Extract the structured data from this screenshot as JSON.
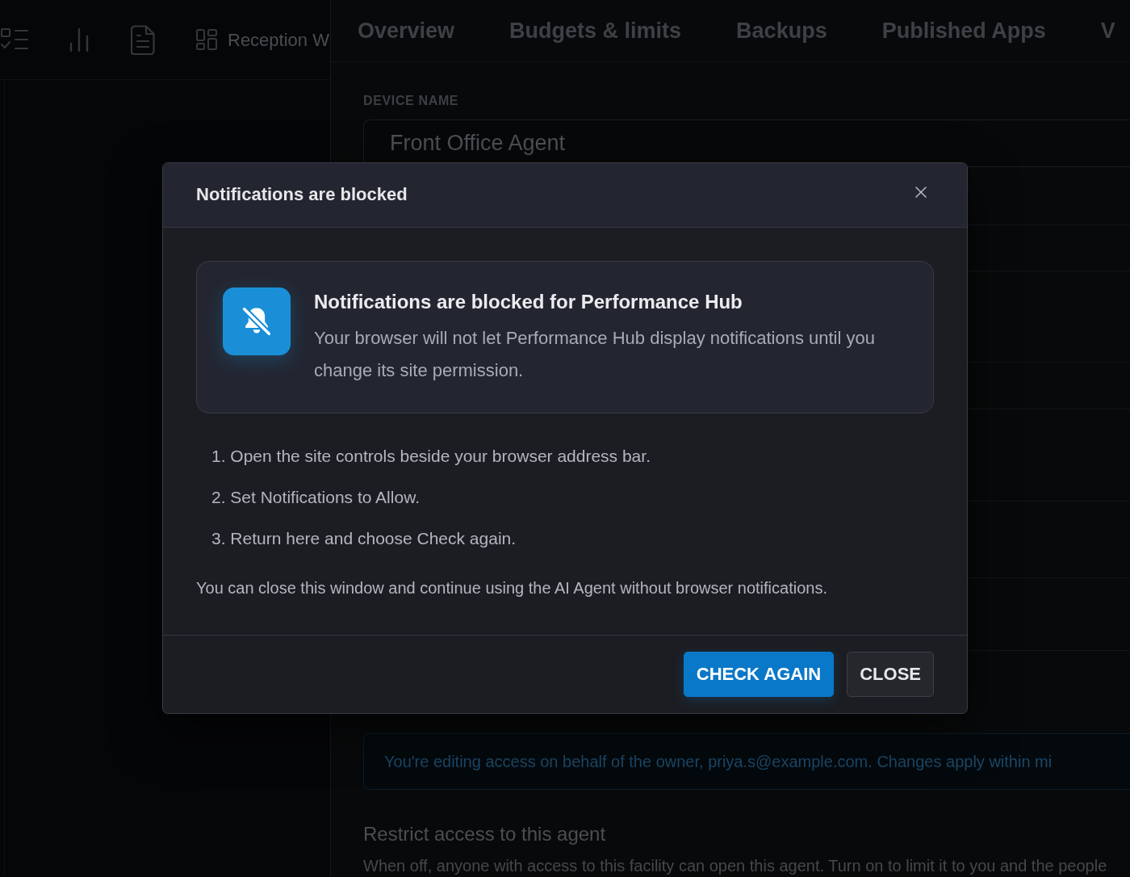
{
  "sidebar": {
    "toolbar_link": "Reception W"
  },
  "tabs": [
    {
      "label": "Overview"
    },
    {
      "label": "Budgets & limits"
    },
    {
      "label": "Backups"
    },
    {
      "label": "Published Apps"
    },
    {
      "label": "V"
    }
  ],
  "device_name": {
    "label": "DEVICE NAME",
    "value": "Front Office Agent"
  },
  "info_alert": {
    "text": "You're editing access on behalf of the owner, priya.s@example.com. Changes apply within mi"
  },
  "restrict_access": {
    "title": "Restrict access to this agent",
    "description": "When off, anyone with access to this facility can open this agent. Turn on to limit it to you and the people"
  },
  "dialog": {
    "title": "Notifications are blocked",
    "alert": {
      "title": "Notifications are blocked for Performance Hub",
      "text": "Your browser will not let Performance Hub display notifications until you change its site permission."
    },
    "steps": [
      "1. Open the site controls beside your browser address bar.",
      "2. Set Notifications to Allow.",
      "3. Return here and choose Check again."
    ],
    "note": "You can close this window and continue using the AI Agent without browser notifications.",
    "buttons": [
      {
        "label": "CHECK AGAIN",
        "kind": "primary"
      },
      {
        "label": "CLOSE",
        "kind": "secondary"
      }
    ]
  }
}
